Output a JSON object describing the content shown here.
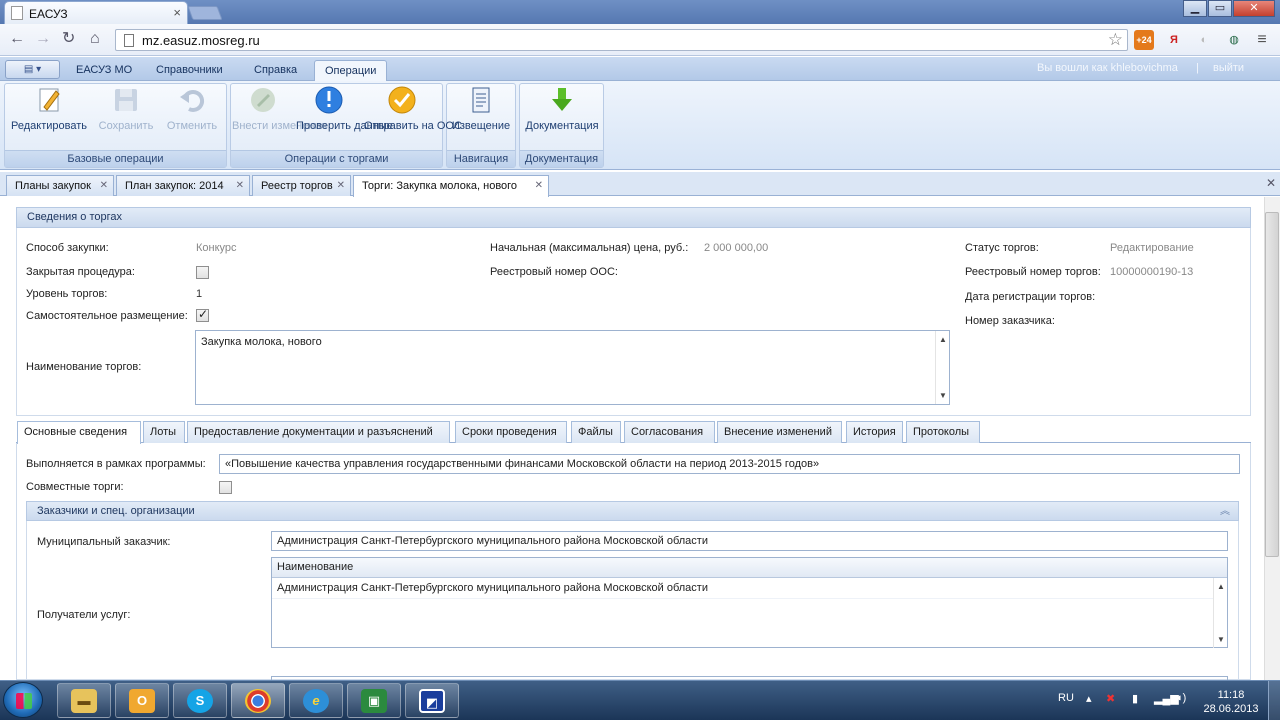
{
  "browser": {
    "tab_title": "ЕАСУЗ",
    "url": "mz.easuz.mosreg.ru",
    "ext_badge": "+24"
  },
  "menu": {
    "items": [
      "ЕАСУЗ МО",
      "Справочники",
      "Справка",
      "Операции"
    ],
    "user_text": "Вы вошли как khlebovichma",
    "exit": "выйти"
  },
  "ribbon": {
    "buttons": {
      "edit": "Редактировать",
      "save": "Сохранить",
      "cancel": "Отменить",
      "apply": "Внести изменения",
      "check": "Проверить данные",
      "send": "Отправить на ООС",
      "notice": "Извещение",
      "docs": "Документация"
    },
    "groups": {
      "base": "Базовые операции",
      "trade": "Операции с торгами",
      "nav": "Навигация",
      "doc": "Документация"
    }
  },
  "doc_tabs": [
    "Планы закупок",
    "План закупок: 2014",
    "Реестр торгов",
    "Торги: Закупка молока, нового"
  ],
  "trade_info": {
    "header": "Сведения о торгах",
    "method_label": "Способ закупки:",
    "method_value": "Конкурс",
    "closed_label": "Закрытая процедура:",
    "level_label": "Уровень торгов:",
    "level_value": "1",
    "self_label": "Самостоятельное размещение:",
    "name_label": "Наименование торгов:",
    "name_value": "Закупка молока, нового",
    "price_label": "Начальная (максимальная) цена, руб.:",
    "price_value": "2 000 000,00",
    "registry_oos_label": "Реестровый номер ООС:",
    "status_label": "Статус торгов:",
    "status_value": "Редактирование",
    "registry_num_label": "Реестровый номер торгов:",
    "registry_num_value": "10000000190-13",
    "reg_date_label": "Дата регистрации торгов:",
    "customer_num_label": "Номер заказчика:"
  },
  "inner_tabs": [
    "Основные сведения",
    "Лоты",
    "Предоставление документации и разъяснений",
    "Сроки проведения",
    "Файлы",
    "Согласования",
    "Внесение изменений",
    "История",
    "Протоколы"
  ],
  "main": {
    "program_label": "Выполняется в рамках программы:",
    "program_value": "«Повышение качества управления государственными финансами Московской области на период 2013-2015 годов»",
    "joint_label": "Совместные торги:",
    "customers_header": "Заказчики и спец. организации",
    "municipal_label": "Муниципальный заказчик:",
    "municipal_value": "Администрация Санкт-Петербургского муниципального района Московской области",
    "recipients_label": "Получатели услуг:",
    "grid_header": "Наименование",
    "grid_rows": [
      "Администрация Санкт-Петербургского муниципального района Московской области"
    ]
  },
  "taskbar": {
    "lang": "RU",
    "time": "11:18",
    "date": "28.06.2013"
  }
}
